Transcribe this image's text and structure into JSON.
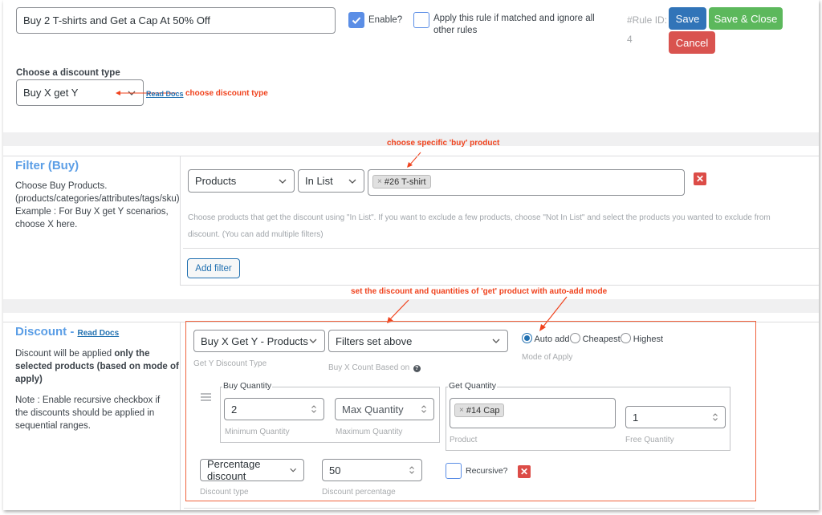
{
  "header": {
    "rule_title_value": "Buy 2 T-shirts and Get a Cap At 50% Off",
    "enable_label": "Enable?",
    "enable_checked": true,
    "apply_exclusive_label_line1": "Apply this rule if matched and ignore all",
    "apply_exclusive_label_line2": "other rules",
    "apply_exclusive_checked": false,
    "rule_id_label": "#Rule ID:",
    "rule_id_value": "4",
    "save_label": "Save",
    "save_close_label": "Save & Close",
    "cancel_label": "Cancel",
    "colors": {
      "save": "#3174b8",
      "save_close": "#5cb85c",
      "cancel": "#d9534f",
      "enable_check": "#5b8ee6"
    }
  },
  "discount_type": {
    "label": "Choose a discount type",
    "selected": "Buy X get Y",
    "read_docs": "Read Docs",
    "annotation": "choose discount type"
  },
  "filter_section": {
    "title": "Filter (Buy)",
    "desc_line1": "Choose Buy Products.",
    "desc_line2": "(products/categories/attributes/tags/sku)",
    "desc_line3": "Example : For Buy X get Y scenarios,",
    "desc_line4": "choose X here.",
    "annotation": "choose specific 'buy' product",
    "filter_type": "Products",
    "filter_method": "In List",
    "selected_products": [
      "#26 T-shirt"
    ],
    "help_line1": "Choose products that get the discount using \"In List\". If you want to exclude a few products, choose \"Not In List\" and select the products you wanted to exclude from",
    "help_line2": "discount. (You can add multiple filters)",
    "add_filter_label": "Add filter"
  },
  "discount_section": {
    "title": "Discount - ",
    "read_docs": "Read Docs",
    "desc_normal": "Discount will be applied ",
    "desc_bold": "only the selected products (based on mode of apply)",
    "note": "Note : Enable recursive checkbox if the discounts should be applied in sequential ranges.",
    "annotation": "set the discount and quantities of 'get' product with auto-add mode",
    "get_y_type": "Buy X Get Y - Products",
    "get_y_type_label": "Get Y Discount Type",
    "buy_x_count": "Filters set above",
    "buy_x_count_label": "Buy X Count Based on",
    "mode_options": [
      "Auto add",
      "Cheapest",
      "Highest"
    ],
    "mode_selected": "Auto add",
    "mode_label": "Mode of Apply",
    "buy_quantity": {
      "legend": "Buy Quantity",
      "min_value": "2",
      "min_label": "Minimum Quantity",
      "max_placeholder": "Max Quantity",
      "max_label": "Maximum Quantity"
    },
    "get_quantity": {
      "legend": "Get Quantity",
      "products": [
        "#14 Cap"
      ],
      "product_label": "Product",
      "free_qty_value": "1",
      "free_qty_label": "Free Quantity"
    },
    "discount_type": "Percentage discount",
    "discount_type_label": "Discount type",
    "discount_value": "50",
    "discount_value_label": "Discount percentage",
    "recursive_label": "Recursive?",
    "recursive_checked": false
  }
}
